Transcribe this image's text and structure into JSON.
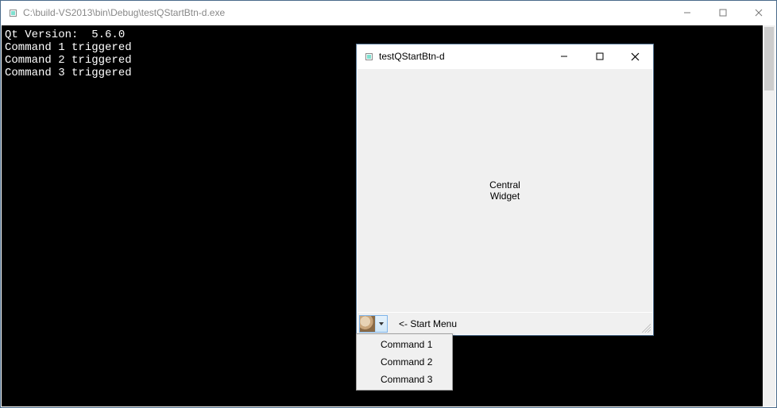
{
  "outer": {
    "title": "C:\\build-VS2013\\bin\\Debug\\testQStartBtn-d.exe"
  },
  "console": {
    "lines": [
      "Qt Version:  5.6.0",
      "Command 1 triggered",
      "Command 2 triggered",
      "Command 3 triggered"
    ]
  },
  "inner": {
    "title": "testQStartBtn-d",
    "central_label": "Central\nWidget",
    "start_hint": "<- Start Menu"
  },
  "menu": {
    "items": [
      "Command 1",
      "Command 2",
      "Command 3"
    ]
  }
}
